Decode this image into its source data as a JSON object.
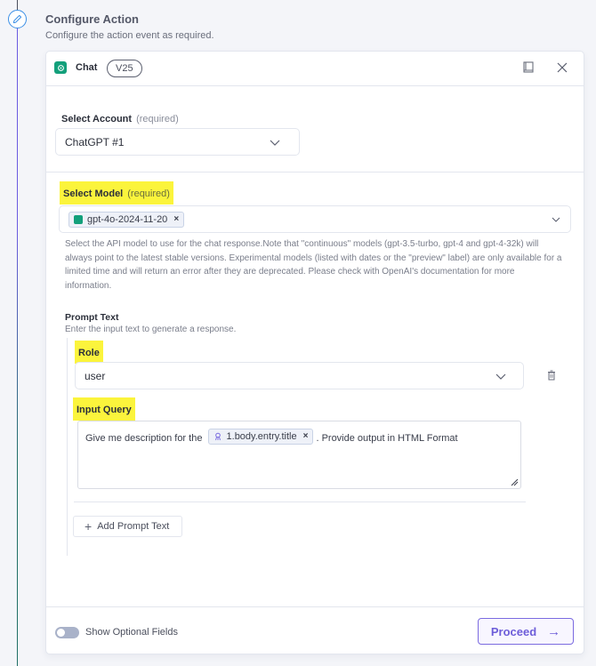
{
  "step": {
    "title": "Configure Action",
    "subtitle": "Configure the action event as required.",
    "icon": "pencil-icon"
  },
  "card": {
    "app_name": "Chat",
    "version": "V25",
    "header_icons": [
      "book-icon",
      "close-icon"
    ]
  },
  "account": {
    "label": "Select Account",
    "required": "(required)",
    "value": "ChatGPT #1"
  },
  "model": {
    "label": "Select Model",
    "required": "(required)",
    "selected_tag": "gpt-4o-2024-11-20",
    "help": "Select the API model to use for the chat response.Note that \"continuous\" models (gpt-3.5-turbo, gpt-4 and gpt-4-32k) will always point to the latest stable versions. Experimental models (listed with dates or the \"preview\" label) are only available for a limited time and will return an error after they are deprecated. Please check with OpenAI's documentation for more information."
  },
  "prompt": {
    "title": "Prompt Text",
    "subtitle": "Enter the input text to generate a response.",
    "role_label": "Role",
    "role_value": "user",
    "query_label": "Input Query",
    "query_prefix": "Give me description for the",
    "query_pill": "1.body.entry.title",
    "query_suffix": ". Provide output in HTML Format",
    "add_button": "Add Prompt Text"
  },
  "footer": {
    "toggle_label": "Show Optional Fields",
    "toggle_on": false,
    "proceed": "Proceed",
    "proceed_arrow": "→"
  },
  "colors": {
    "accent": "#6d5dd9",
    "highlight": "#fbf43c",
    "openai_green": "#13a07b"
  }
}
